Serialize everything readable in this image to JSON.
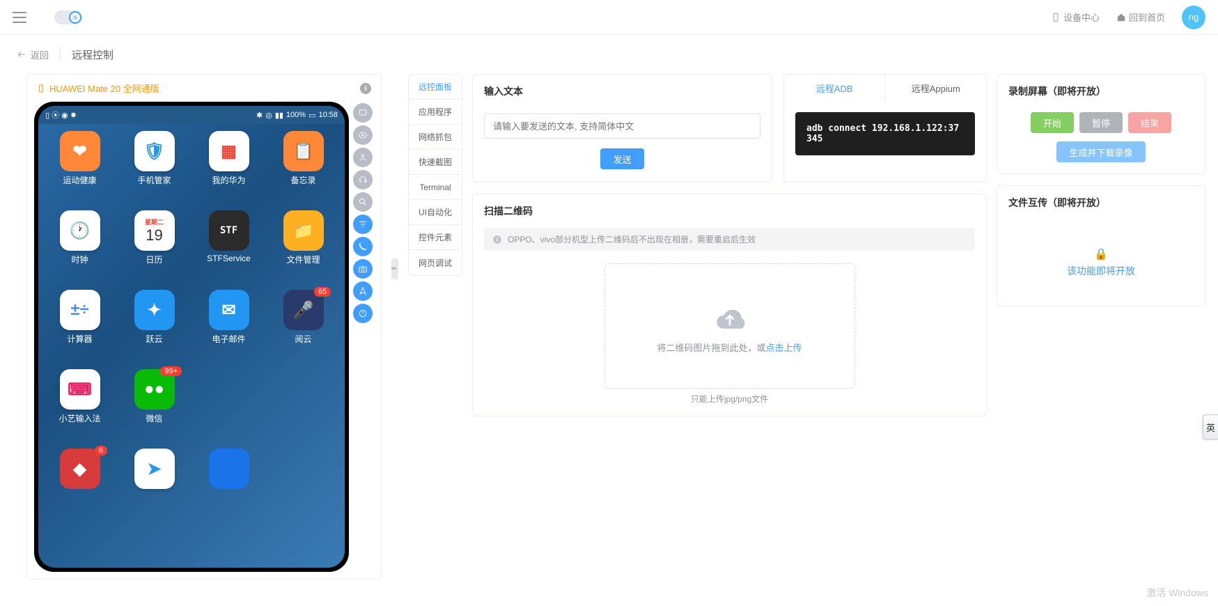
{
  "topbar": {
    "device_center": "设备中心",
    "back_home": "回到首页",
    "avatar": "ng"
  },
  "subheader": {
    "back": "返回",
    "title": "远程控制"
  },
  "device": {
    "name": "HUAWEI Mate 20 全网通版",
    "status_left": "▯ ⦿ ◉ ✸",
    "status_bt": "✱",
    "status_loc": "◎",
    "status_signal": "▮▮",
    "status_battery": "100%",
    "status_charge": "▭",
    "status_time": "10:58",
    "apps": [
      {
        "label": "运动健康",
        "bg": "#ff8838",
        "txt": "❤"
      },
      {
        "label": "手机管家",
        "bg": "#ffffff",
        "txt": "🛡",
        "fg": "#2196f3"
      },
      {
        "label": "我的华为",
        "bg": "#ffffff",
        "txt": "▦",
        "fg": "#f44336"
      },
      {
        "label": "备忘录",
        "bg": "#ff8838",
        "txt": "📋"
      },
      {
        "label": "时钟",
        "bg": "#ffffff",
        "txt": "🕐",
        "fg": "#333"
      },
      {
        "label": "日历",
        "bg": "#ffffff",
        "txt": "19",
        "fg": "#333",
        "sub": "星期二"
      },
      {
        "label": "STFService",
        "bg": "#2a2a2a",
        "txt": "STF"
      },
      {
        "label": "文件管理",
        "bg": "#ffb020",
        "txt": "📁"
      },
      {
        "label": "计算器",
        "bg": "#ffffff",
        "txt": "±÷",
        "fg": "#4a90e2"
      },
      {
        "label": "跃云",
        "bg": "#2196f3",
        "txt": "✦"
      },
      {
        "label": "电子邮件",
        "bg": "#2196f3",
        "txt": "✉",
        "badge": ""
      },
      {
        "label": "阅云",
        "bg": "#2a3a6a",
        "txt": "🎤",
        "badge": "65"
      },
      {
        "label": "小艺输入法",
        "bg": "#ffffff",
        "txt": "⌨",
        "fg": "#e91e63"
      },
      {
        "label": "微信",
        "bg": "#09bb07",
        "txt": "●●",
        "badge": "99+"
      },
      {
        "label": "",
        "bg": "transparent",
        "txt": ""
      },
      {
        "label": "",
        "bg": "transparent",
        "txt": ""
      },
      {
        "label": "",
        "bg": "#d63a3a",
        "txt": "◆",
        "badge": "6"
      },
      {
        "label": "",
        "bg": "#ffffff",
        "txt": "➤",
        "fg": "#2196f3"
      },
      {
        "label": "",
        "bg": "#1a73e8",
        "txt": ""
      },
      {
        "label": "",
        "bg": "transparent",
        "txt": ""
      }
    ]
  },
  "vtabs": [
    "远控面板",
    "应用程序",
    "网络抓包",
    "快速截图",
    "Terminal",
    "UI自动化",
    "控件元素",
    "网页调试"
  ],
  "input_text": {
    "title": "输入文本",
    "placeholder": "请输入要发送的文本, 支持简体中文",
    "send": "发送"
  },
  "adb": {
    "tab_adb": "远程ADB",
    "tab_appium": "远程Appium",
    "command": "adb connect 192.168.1.122:37345"
  },
  "qr": {
    "title": "扫描二维码",
    "alert": "OPPO、vivo部分机型上传二维码后不出现在相册，需要重启后生效",
    "drop_text": "将二维码图片拖到此处，或",
    "drop_link": "点击上传",
    "hint": "只能上传jpg/png文件"
  },
  "record": {
    "title": "录制屏幕（即将开放）",
    "start": "开始",
    "pause": "暂停",
    "end": "结束",
    "download": "生成并下载录像"
  },
  "file": {
    "title": "文件互传（即将开放）",
    "msg": "该功能即将开放"
  },
  "watermark": {
    "l1": "激活 Windows",
    "l2": ""
  },
  "float_tab": "英"
}
